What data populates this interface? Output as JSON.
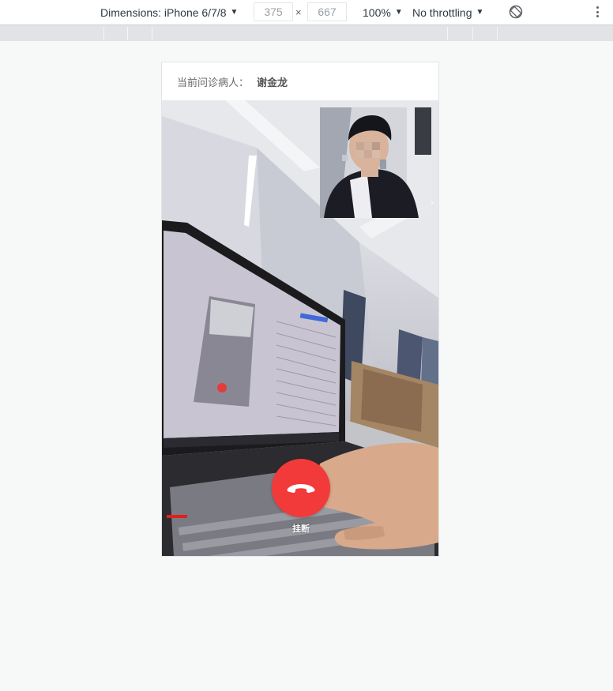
{
  "devtools": {
    "device_label": "Dimensions: iPhone 6/7/8",
    "width_value": "375",
    "height_value": "667",
    "times": "×",
    "zoom_label": "100%",
    "throttling_label": "No throttling",
    "icons": [
      "rotate-icon",
      "more-options-icon"
    ]
  },
  "page": {
    "patient_label": "当前问诊病人：",
    "patient_name": "谢金龙",
    "hangup_label": "挂断",
    "icons": [
      "phone-hangup-icon"
    ],
    "colors": {
      "hangup": "#f23a3a",
      "background": "#f7f8f8"
    }
  }
}
